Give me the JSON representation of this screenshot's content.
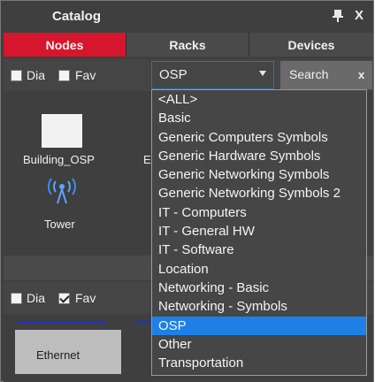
{
  "window": {
    "title": "Catalog",
    "close_label": "X"
  },
  "tabs": [
    {
      "label": "Nodes",
      "active": true
    },
    {
      "label": "Racks",
      "active": false
    },
    {
      "label": "Devices",
      "active": false
    }
  ],
  "filters_top": {
    "dia_label": "Dia",
    "dia_checked": false,
    "fav_label": "Fav",
    "fav_checked": false
  },
  "category_select": {
    "value": "OSP"
  },
  "search": {
    "label": "Search",
    "clear_label": "x"
  },
  "nodes": [
    {
      "label": "Building_OSP"
    },
    {
      "label": "E"
    },
    {
      "label": "Tower"
    }
  ],
  "filters_bottom": {
    "dia_label": "Dia",
    "dia_checked": false,
    "fav_label": "Fav",
    "fav_checked": true
  },
  "links": [
    {
      "label": "Ethernet"
    }
  ],
  "dropdown_options": [
    "<ALL>",
    "Basic",
    "Generic Computers Symbols",
    "Generic Hardware Symbols",
    "Generic Networking Symbols",
    "Generic Networking Symbols 2",
    "IT - Computers",
    "IT - General HW",
    "IT - Software",
    "Location",
    "Networking - Basic",
    "Networking - Symbols",
    "OSP",
    "Other",
    "Transportation"
  ],
  "dropdown_selected_index": 12,
  "colors": {
    "active_tab": "#d6162c",
    "selected_option": "#1e80e6",
    "link_line": "#1a2fd6",
    "panel_bg": "#3f3f3f"
  }
}
